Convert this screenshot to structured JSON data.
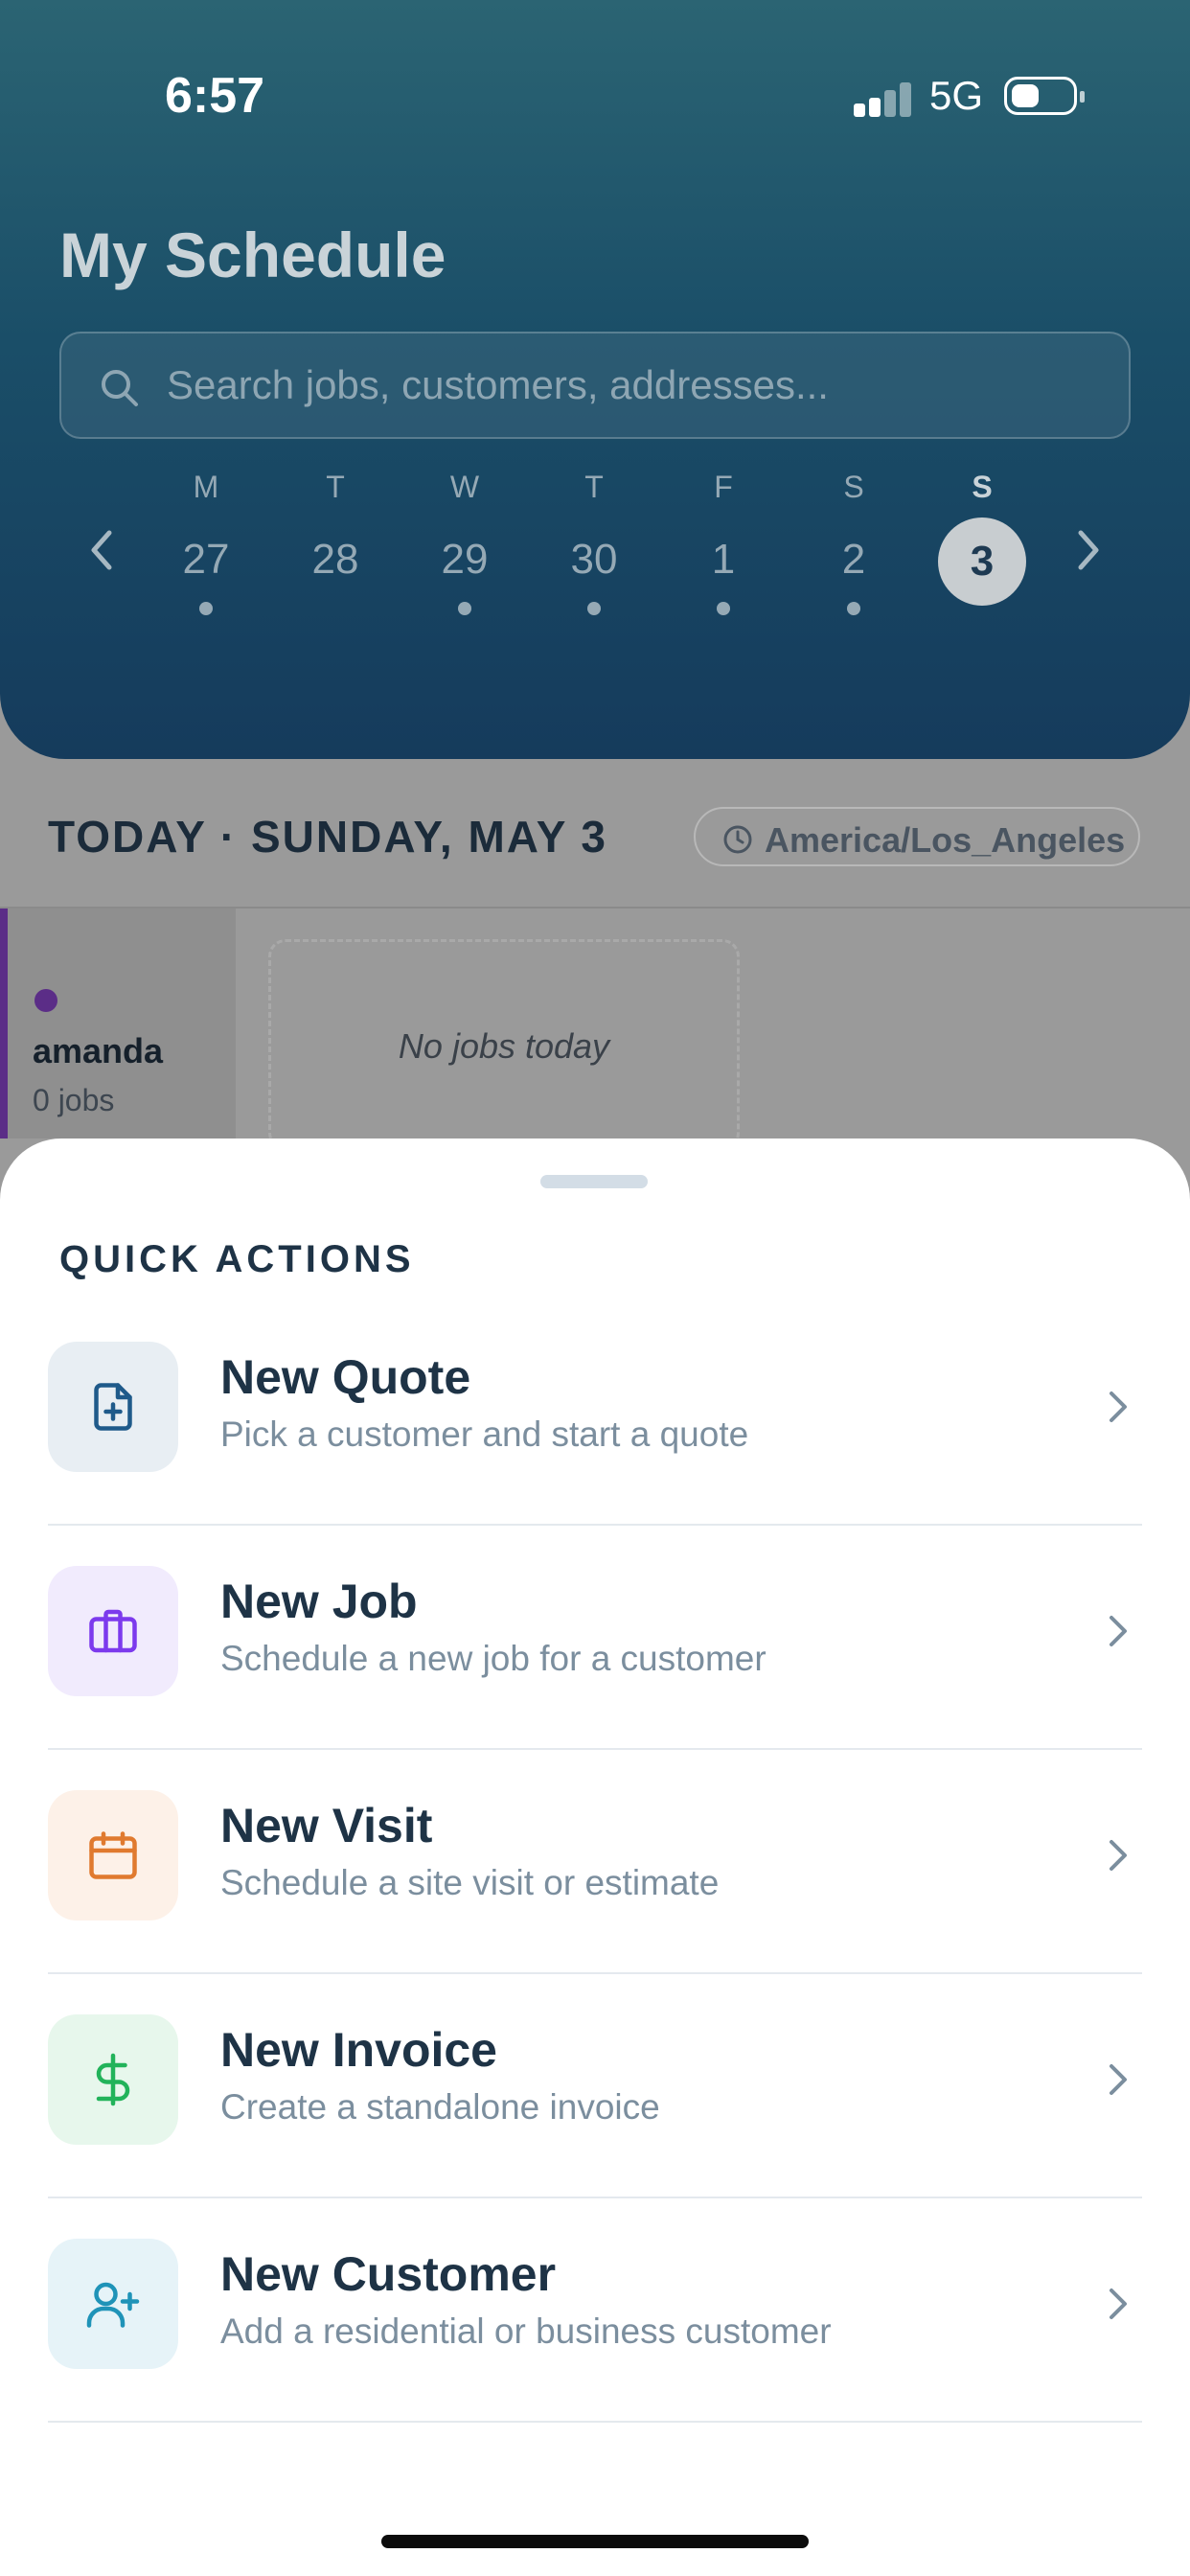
{
  "status": {
    "time": "6:57",
    "network": "5G"
  },
  "header": {
    "title": "My Schedule",
    "search_placeholder": "Search jobs, customers, addresses..."
  },
  "week": [
    {
      "label": "M",
      "date": "27",
      "has_jobs": true
    },
    {
      "label": "T",
      "date": "28",
      "has_jobs": false
    },
    {
      "label": "W",
      "date": "29",
      "has_jobs": true
    },
    {
      "label": "T",
      "date": "30",
      "has_jobs": true
    },
    {
      "label": "F",
      "date": "1",
      "has_jobs": true
    },
    {
      "label": "S",
      "date": "2",
      "has_jobs": true
    },
    {
      "label": "S",
      "date": "3",
      "has_jobs": false,
      "selected": true
    }
  ],
  "today": {
    "label": "TODAY · SUNDAY, MAY 3",
    "timezone": "America/Los_Angeles"
  },
  "technicians": [
    {
      "name": "amanda",
      "jobs": "0 jobs",
      "color": "#5b2d87"
    }
  ],
  "empty_state": "No jobs today",
  "quick_actions": {
    "title": "QUICK ACTIONS",
    "items": [
      {
        "title": "New Quote",
        "subtitle": "Pick a customer and start a quote",
        "icon": "file-plus-icon",
        "color": "#1f5a8a",
        "bg": "#e8eef3"
      },
      {
        "title": "New Job",
        "subtitle": "Schedule a new job for a customer",
        "icon": "briefcase-icon",
        "color": "#7c3aed",
        "bg": "#f1ebfd"
      },
      {
        "title": "New Visit",
        "subtitle": "Schedule a site visit or estimate",
        "icon": "calendar-icon",
        "color": "#e07a2f",
        "bg": "#fdf1e8"
      },
      {
        "title": "New Invoice",
        "subtitle": "Create a standalone invoice",
        "icon": "dollar-icon",
        "color": "#22b35a",
        "bg": "#e7f7ec"
      },
      {
        "title": "New Customer",
        "subtitle": "Add a residential or business customer",
        "icon": "user-plus-icon",
        "color": "#1f93b8",
        "bg": "#e6f3f8"
      }
    ]
  }
}
